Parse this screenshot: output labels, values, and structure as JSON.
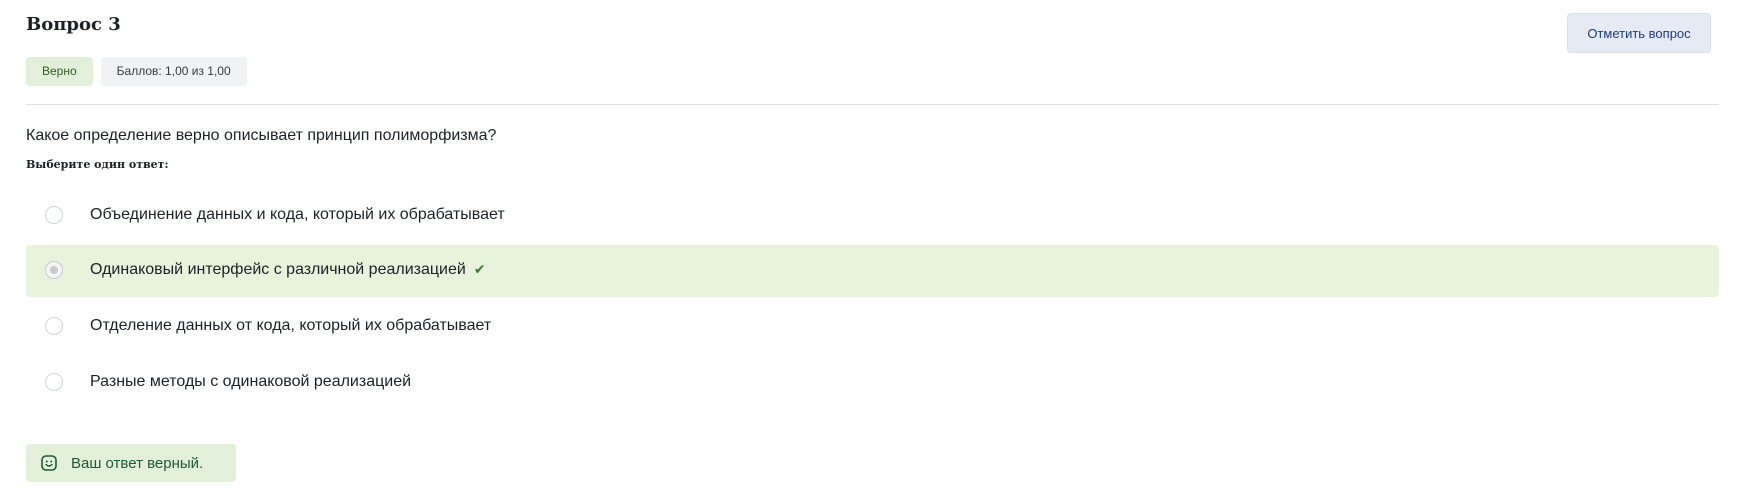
{
  "question": {
    "title": "Вопрос 3",
    "status_badge": "Верно",
    "score_badge": "Баллов: 1,00 из 1,00",
    "flag_button": "Отметить вопрос",
    "text": "Какое определение верно описывает принцип полиморфизма?",
    "prompt": "Выберите один ответ:"
  },
  "answers": [
    {
      "label": "Объединение данных и кода, который их обрабатывает",
      "selected": false
    },
    {
      "label": "Одинаковый интерфейс с различной реализацией",
      "selected": true,
      "icon": "check-icon"
    },
    {
      "label": "Отделение данных от кода, который их обрабатывает",
      "selected": false
    },
    {
      "label": "Разные методы с одинаковой реализацией",
      "selected": false
    }
  ],
  "feedback": {
    "icon": "smile-icon",
    "text": "Ваш ответ верный."
  },
  "colors": {
    "correct_bg": "#e8f3dc",
    "correct_text": "#1e5a38",
    "check": "#357a32",
    "flag_bg": "#e6eaf5"
  }
}
